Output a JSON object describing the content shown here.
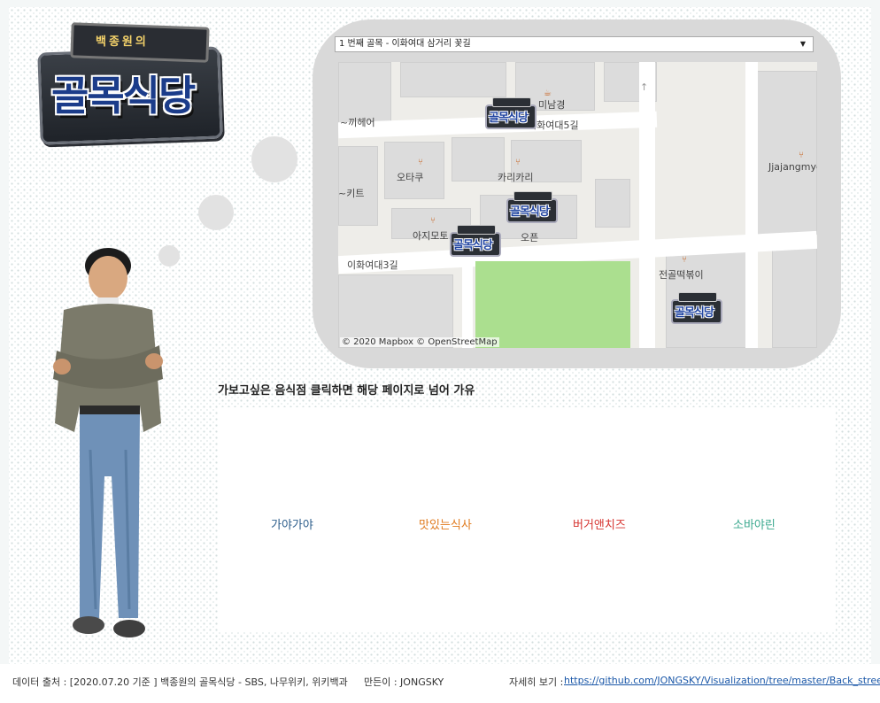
{
  "logo": {
    "small_text": "백종원의",
    "title": "골목식당"
  },
  "map": {
    "dropdown_value": "1 번째 골목 - 이화여대 삼거리 꽃길",
    "streets": [
      "이화여대5길",
      "이화여대3길"
    ],
    "places": [
      "미남경",
      "~끼헤어",
      "오타쿠",
      "카리카리",
      "Jjajangmye",
      "~키트",
      "아지모토",
      "오픈",
      "전골떡볶이"
    ],
    "marker_label": "골목식당",
    "attribution": "© 2020 Mapbox  © OpenStreetMap"
  },
  "section": {
    "title": "가보고싶은 음식점 클릭하면 해당 페이지로 넘어 가유"
  },
  "restaurants": [
    {
      "name": "가야가야",
      "color": "#2b5c8a"
    },
    {
      "name": "맛있는식사",
      "color": "#e07b1f"
    },
    {
      "name": "버거앤치즈",
      "color": "#d6332f"
    },
    {
      "name": "소바야린",
      "color": "#3aa88e"
    }
  ],
  "footer": {
    "source": "데이터 출처 : [2020.07.20 기준 ] 백종원의 골목식당 - SBS, 나무위키, 위키백과",
    "author": "만든이 : JONGSKY",
    "detail_label": "자세히 보기 :",
    "detail_link": "https://github.com/JONGSKY/Visualization/tree/master/Back_street"
  }
}
